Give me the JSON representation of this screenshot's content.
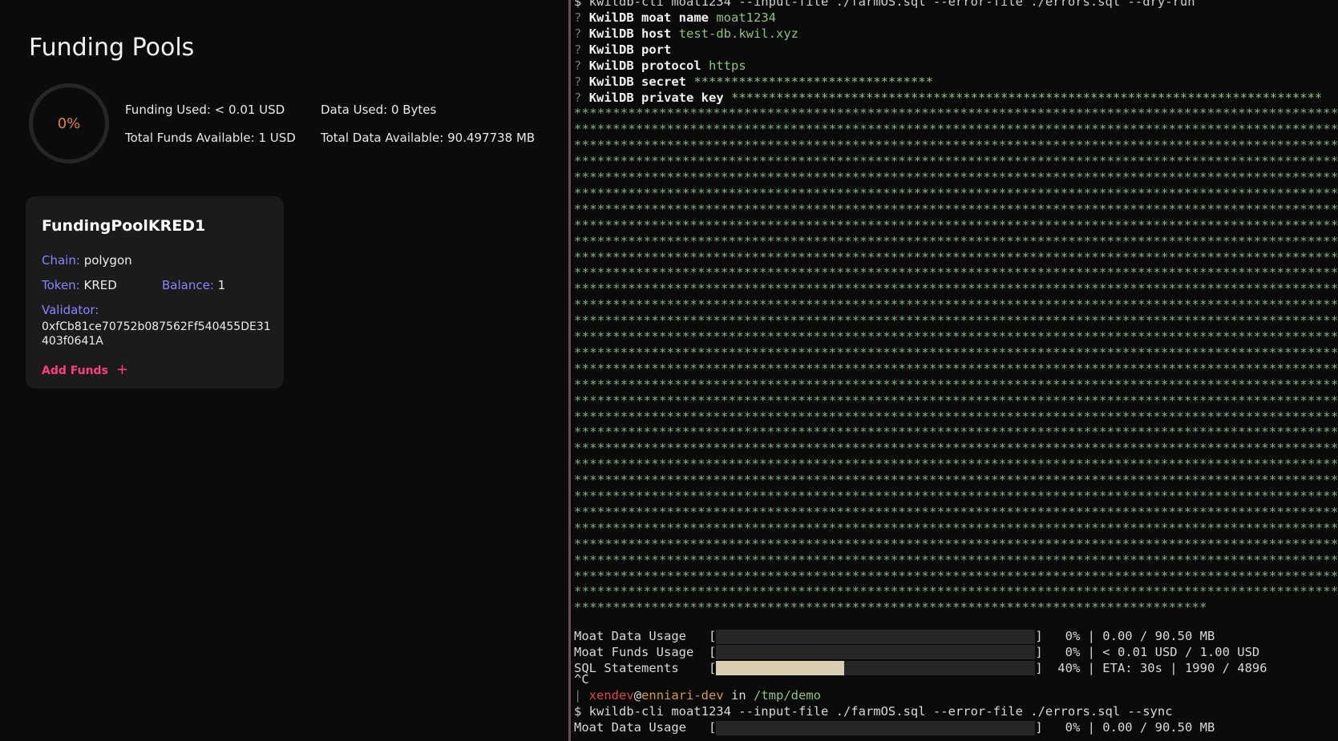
{
  "left": {
    "title": "Funding Pools",
    "ring_label": "0%",
    "funding_used": "Funding Used: < 0.01 USD",
    "total_funds": "Total Funds Available: 1 USD",
    "data_used": "Data Used: 0 Bytes",
    "total_data": "Total Data Available: 90.497738 MB",
    "pool": {
      "name": "FundingPoolKRED1",
      "chain_label": "Chain:",
      "chain": "polygon",
      "token_label": "Token:",
      "token": "KRED",
      "balance_label": "Balance:",
      "balance": "1",
      "validator_label": "Validator:",
      "validator": "0xfCb81ce70752b087562Ff540455DE31403f0641A",
      "add_funds": "Add Funds",
      "plus": "+"
    }
  },
  "terminal": {
    "cmd_top": "$ kwildb-cli moat1234 --input-file ./farmOS.sql --error-file ./errors.sql --dry-run",
    "prompts": [
      {
        "q": "?",
        "k": "KwilDB moat name",
        "v": "moat1234"
      },
      {
        "q": "?",
        "k": "KwilDB host",
        "v": "test-db.kwil.xyz"
      },
      {
        "q": "?",
        "k": "KwilDB port",
        "v": ""
      },
      {
        "q": "?",
        "k": "KwilDB protocol",
        "v": "https"
      },
      {
        "q": "?",
        "k": "KwilDB secret",
        "v": "********************************"
      },
      {
        "q": "?",
        "k": "KwilDB private key",
        "v": "*******************************************************************************"
      }
    ],
    "star_line": "*******************************************************************************************************",
    "star_last": "**********************************************************************************",
    "progress": [
      {
        "label": "Moat Data Usage   [",
        "percent": 0,
        "stats": "]   0% | 0.00 / 90.50 MB"
      },
      {
        "label": "Moat Funds Usage  [",
        "percent": 0,
        "stats": "]   0% | < 0.01 USD / 1.00 USD"
      },
      {
        "label": "SQL Statements    [",
        "percent": 40,
        "stats": "]  40% | ETA: 30s | 1990 / 4896"
      }
    ],
    "ctrl_c": "^C",
    "prompt_bar": "|",
    "user": "xendev",
    "at": "@",
    "host": "enniari-dev",
    "in": " in ",
    "path": "/tmp/demo",
    "cmd_sync": "$ kwildb-cli moat1234 --input-file ./farmOS.sql --error-file ./errors.sql --sync",
    "last_progress": {
      "label": "Moat Data Usage   [",
      "percent": 0,
      "stats": "]   0% | 0.00 / 90.50 MB"
    }
  }
}
